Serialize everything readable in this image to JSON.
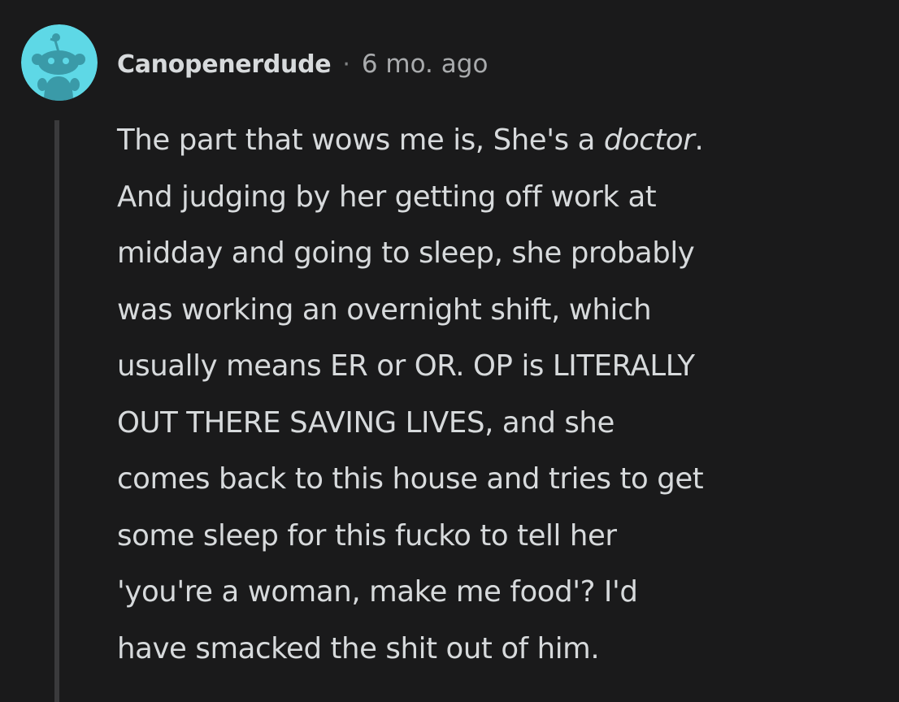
{
  "comment": {
    "avatar_icon": "reddit-snoo-avatar-icon",
    "avatar_color": "#5ed8e6",
    "username": "Canopenerdude",
    "separator": "·",
    "timestamp": "6 mo. ago",
    "body": {
      "line1_before": "The part that wows me is, She's a ",
      "line1_emphasis": "doctor",
      "line1_after": ".",
      "line2": "And judging by her getting off work at",
      "line3": "midday and going to sleep, she probably",
      "line4": "was working an overnight shift, which",
      "line5": "usually means ER or OR. OP is LITERALLY",
      "line6": "OUT THERE SAVING LIVES, and she",
      "line7": "comes back to this house and tries to get",
      "line8": "some sleep for this fucko to tell her",
      "line9": "'you're a woman, make me food'? I'd",
      "line10": "have smacked the shit out of him."
    }
  }
}
